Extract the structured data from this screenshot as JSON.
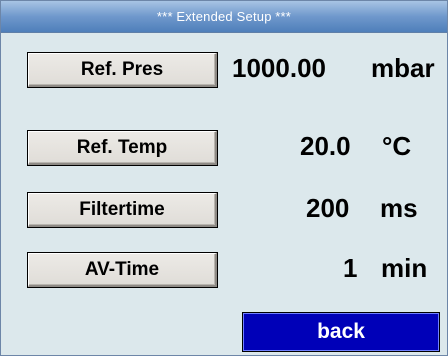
{
  "title": {
    "stars_left": "***",
    "text": "Extended Setup",
    "stars_right": "***"
  },
  "rows": [
    {
      "label": "Ref. Pres",
      "value": "1000.00",
      "unit": "mbar"
    },
    {
      "label": "Ref. Temp",
      "value": "20.0",
      "unit": "°C"
    },
    {
      "label": "Filtertime",
      "value": "200",
      "unit": "ms"
    },
    {
      "label": "AV-Time",
      "value": "1",
      "unit": "min"
    }
  ],
  "back": {
    "label": "back"
  },
  "colors": {
    "background": "#dce8ec",
    "title_bar": "#6f98cc",
    "back_button": "#0000b8"
  }
}
